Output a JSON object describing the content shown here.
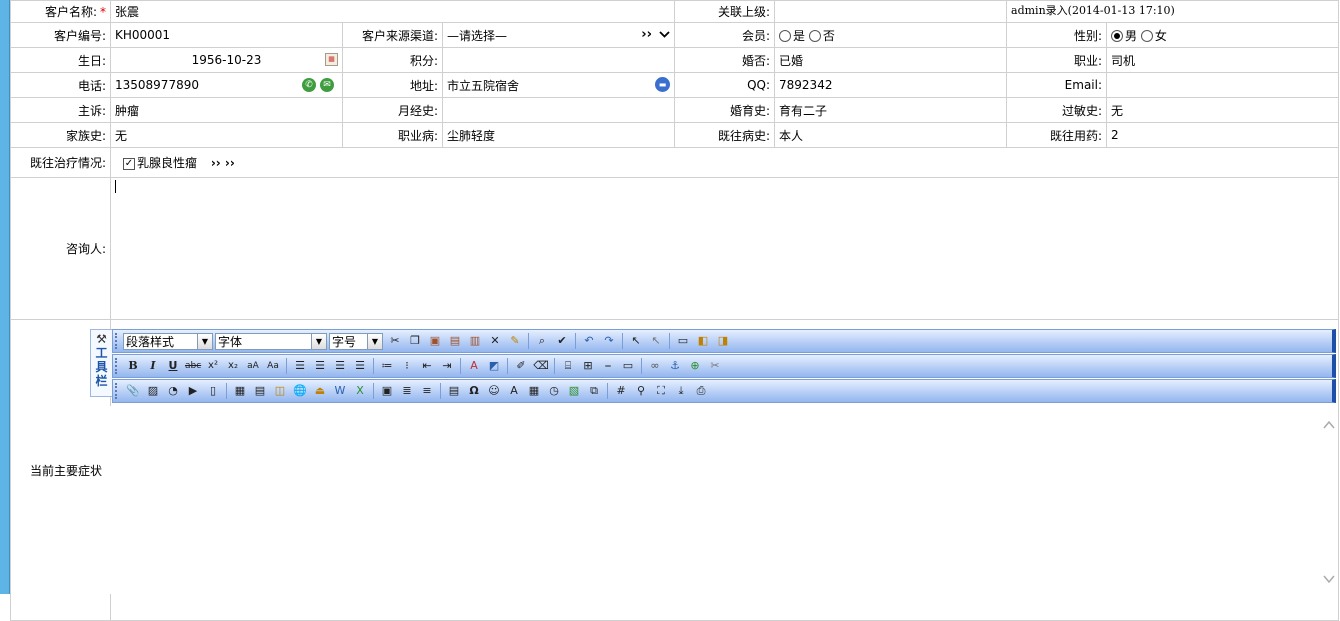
{
  "customer": {
    "name_label": "客户名称:",
    "required_mark": "*",
    "name": "张震",
    "superior_label": "关联上级:",
    "superior": "",
    "entry_info": "admin录入(2014-01-13 17:10)",
    "code_label": "客户编号:",
    "code": "KH00001",
    "source_label": "客户来源渠道:",
    "source_value": "—请选择—",
    "source_more": "››",
    "member_label": "会员:",
    "member_yes": "是",
    "member_no": "否",
    "gender_label": "性别:",
    "gender_male": "男",
    "gender_female": "女",
    "birthday_label": "生日:",
    "birthday": "1956-10-23",
    "points_label": "积分:",
    "points": "",
    "married_label": "婚否:",
    "married": "已婚",
    "job_label": "职业:",
    "job": "司机",
    "phone_label": "电话:",
    "phone": "13508977890",
    "address_label": "地址:",
    "address": "市立五院宿舍",
    "qq_label": "QQ:",
    "qq": "7892342",
    "email_label": "Email:",
    "email": "",
    "complaint_label": "主诉:",
    "complaint": "肿瘤",
    "menstrual_label": "月经史:",
    "menstrual": "",
    "childbearing_label": "婚育史:",
    "childbearing": "育有二子",
    "allergy_label": "过敏史:",
    "allergy": "无",
    "family_label": "家族史:",
    "family": "无",
    "occupational_label": "职业病:",
    "occupational": "尘肺轻度",
    "past_label": "既往病史:",
    "past": "本人",
    "medication_label": "既往用药:",
    "medication": "2",
    "treatment_label": "既往治疗情况:",
    "treatment_item": "乳腺良性瘤",
    "treatment_more": "›› ››",
    "consultant_label": "咨询人:",
    "symptoms_label": "当前主要症状:"
  },
  "editor": {
    "toolbar_tab": "工具栏",
    "paragraph_style": "段落样式",
    "font": "字体",
    "font_size": "字号",
    "dropdown_arrow": "▼"
  },
  "colors": {
    "left_bar": "#5fb4e6",
    "toolbar_edge": "#1d4fa8",
    "required": "#e00000"
  }
}
